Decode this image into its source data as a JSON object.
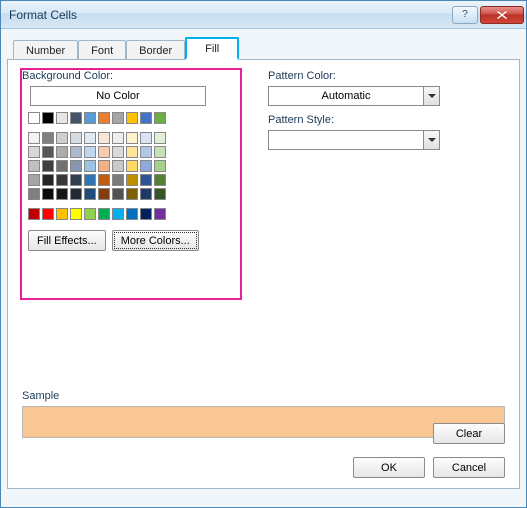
{
  "window": {
    "title": "Format Cells"
  },
  "tabs": {
    "items": [
      {
        "label": "Number"
      },
      {
        "label": "Font"
      },
      {
        "label": "Border"
      },
      {
        "label": "Fill"
      }
    ]
  },
  "fill": {
    "bg_label_full": "Background Color:",
    "no_color_label": "No Color",
    "fill_effects_label": "Fill Effects...",
    "more_colors_label": "More Colors...",
    "swatch_rows": {
      "main_top": [
        "#ffffff",
        "#000000",
        "#e7e6e6",
        "#44546a",
        "#5b9bd5",
        "#ed7d31",
        "#a5a5a5",
        "#ffc000",
        "#4472c4",
        "#70ad47"
      ],
      "accent_row": [
        "#f4b183"
      ],
      "tints": [
        [
          "#f2f2f2",
          "#7f7f7f",
          "#d0cece",
          "#d6dce4",
          "#deebf6",
          "#fbe5d5",
          "#ededed",
          "#fff2cc",
          "#d9e2f3",
          "#e2efd9"
        ],
        [
          "#d8d8d8",
          "#595959",
          "#aeabab",
          "#adb9ca",
          "#bdd7ee",
          "#f7cbac",
          "#dbdbdb",
          "#fee599",
          "#b4c6e7",
          "#c5e0b3"
        ],
        [
          "#bfbfbf",
          "#3f3f3f",
          "#757070",
          "#8496b0",
          "#9cc3e5",
          "#f4b183",
          "#c9c9c9",
          "#ffd965",
          "#8eaadb",
          "#a8d08d"
        ],
        [
          "#a5a5a5",
          "#262626",
          "#3a3838",
          "#323f4f",
          "#2e75b5",
          "#c55a11",
          "#7b7b7b",
          "#bf9000",
          "#2f5496",
          "#538135"
        ],
        [
          "#7f7f7f",
          "#0c0c0c",
          "#171616",
          "#222a35",
          "#1e4e79",
          "#833c0b",
          "#525252",
          "#7f6000",
          "#1f3864",
          "#375623"
        ]
      ],
      "standard": [
        "#c00000",
        "#ff0000",
        "#ffc000",
        "#ffff00",
        "#92d050",
        "#00b050",
        "#00b0f0",
        "#0070c0",
        "#002060",
        "#7030a0"
      ]
    }
  },
  "pattern": {
    "color_label_full": "Pattern Color:",
    "color_value": "Automatic",
    "style_label_full": "Pattern Style:",
    "style_value": ""
  },
  "sample": {
    "label_full": "Sample",
    "color": "#f9c793"
  },
  "buttons": {
    "clear": "Clear",
    "ok": "OK",
    "cancel": "Cancel"
  }
}
